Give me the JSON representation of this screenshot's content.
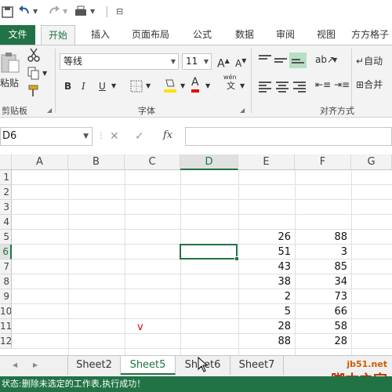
{
  "qat": {
    "title_glyph": "⊟"
  },
  "tabs": {
    "file": "文件",
    "items": [
      "开始",
      "插入",
      "页面布局",
      "公式",
      "数据",
      "审阅",
      "视图",
      "方方格子"
    ],
    "active": "开始"
  },
  "ribbon": {
    "clipboard": {
      "label": "剪贴板",
      "paste": "粘贴"
    },
    "font": {
      "label": "字体",
      "font_name": "等线",
      "font_size": "11",
      "wen_top": "wén",
      "wen_bottom": "文"
    },
    "alignment": {
      "label": "对齐方式",
      "wrap": "自动",
      "merge": "合并"
    }
  },
  "formula_bar": {
    "name_box": "D6",
    "fx": "fx",
    "value": ""
  },
  "grid": {
    "columns": [
      "A",
      "B",
      "C",
      "D",
      "E",
      "F",
      "G"
    ],
    "selected_column": "D",
    "rows": [
      "1",
      "2",
      "3",
      "4",
      "5",
      "6",
      "7",
      "8",
      "9",
      "10",
      "11",
      "12"
    ],
    "selected_row": "6",
    "col_E": [
      "",
      "",
      "",
      "",
      "26",
      "51",
      "43",
      "38",
      "2",
      "5",
      "28",
      "88"
    ],
    "col_F": [
      "",
      "",
      "",
      "",
      "88",
      "3",
      "85",
      "34",
      "73",
      "66",
      "58",
      "28"
    ],
    "annotation": "v",
    "annotation_color": "#e00000"
  },
  "sheets": {
    "tabs": [
      "Sheet2",
      "Sheet5",
      "Sheet6",
      "Sheet7"
    ],
    "active": "Sheet5"
  },
  "status_text": "状态:删除未选定的工作表,执行成功！",
  "watermark": {
    "line1": "jb51.net",
    "line2": "脚本之家"
  },
  "colors": {
    "accent": "#217346",
    "ribbon_bg": "#f3f3f3"
  }
}
